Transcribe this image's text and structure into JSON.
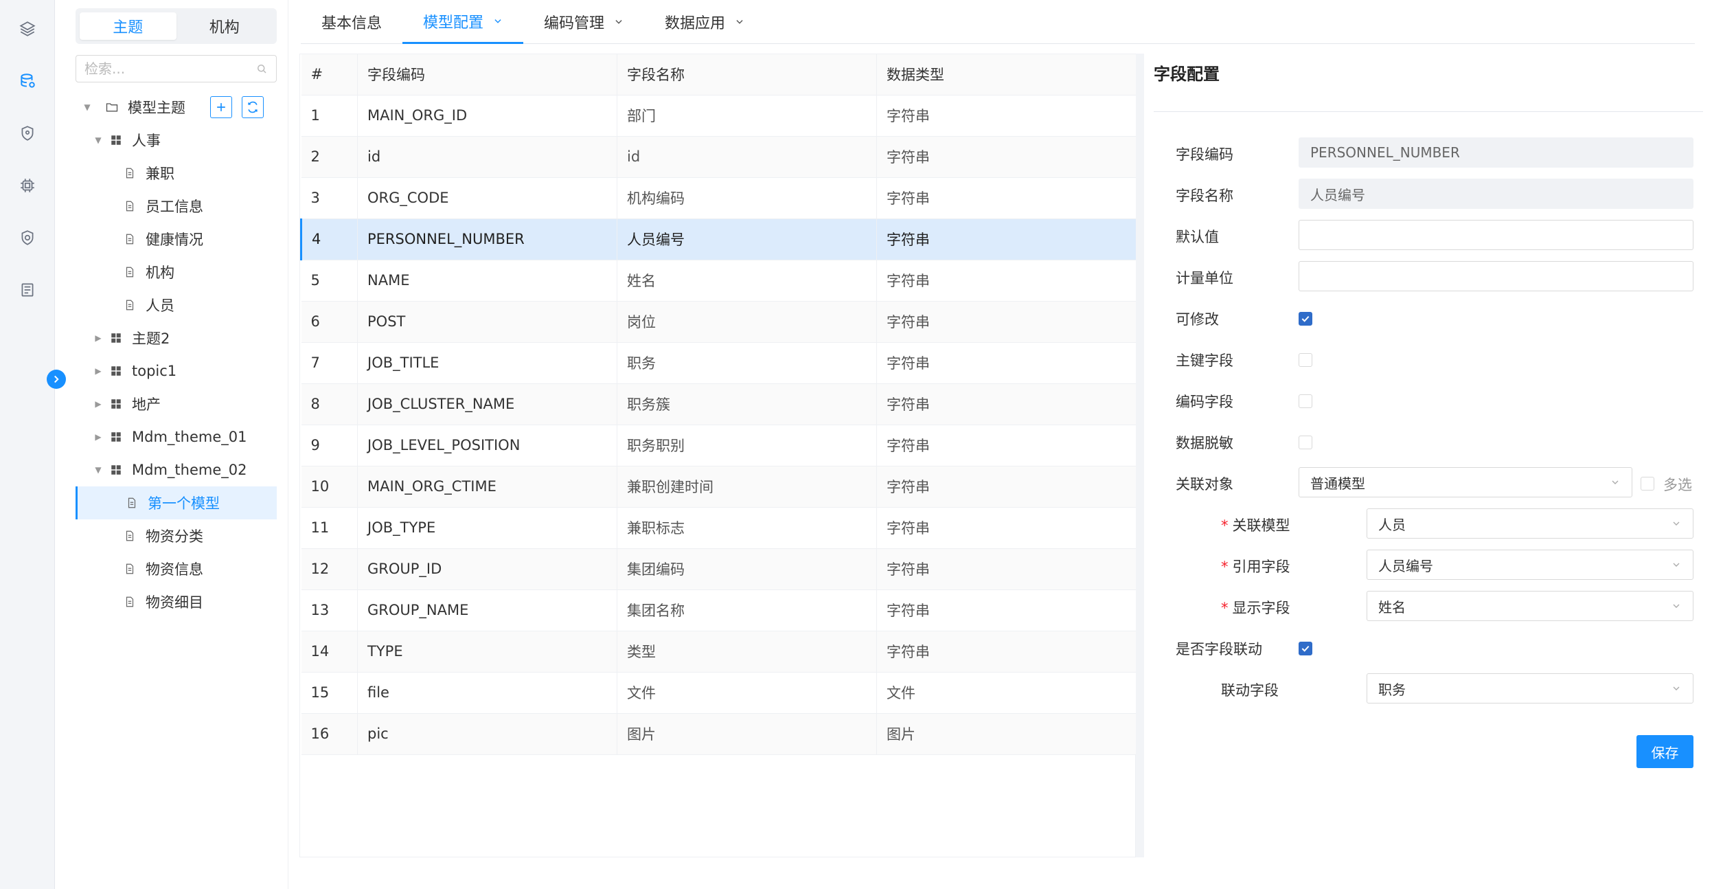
{
  "tree_panel": {
    "segments": [
      "主题",
      "机构"
    ],
    "active_segment": 0,
    "search_placeholder": "检索...",
    "root_label": "模型主题",
    "nodes": [
      {
        "label": "人事",
        "type": "group",
        "level": 1,
        "expanded": true
      },
      {
        "label": "兼职",
        "type": "doc",
        "level": 2
      },
      {
        "label": "员工信息",
        "type": "doc",
        "level": 2
      },
      {
        "label": "健康情况",
        "type": "doc",
        "level": 2
      },
      {
        "label": "机构",
        "type": "doc",
        "level": 2
      },
      {
        "label": "人员",
        "type": "doc",
        "level": 2
      },
      {
        "label": "主题2",
        "type": "group",
        "level": 1,
        "expanded": false
      },
      {
        "label": "topic1",
        "type": "group",
        "level": 1,
        "expanded": false
      },
      {
        "label": "地产",
        "type": "group",
        "level": 1,
        "expanded": false
      },
      {
        "label": "Mdm_theme_01",
        "type": "group",
        "level": 1,
        "expanded": false
      },
      {
        "label": "Mdm_theme_02",
        "type": "group",
        "level": 1,
        "expanded": true
      },
      {
        "label": "第一个模型",
        "type": "doc",
        "level": 2,
        "selected": true
      },
      {
        "label": "物资分类",
        "type": "doc",
        "level": 2
      },
      {
        "label": "物资信息",
        "type": "doc",
        "level": 2
      },
      {
        "label": "物资细目",
        "type": "doc",
        "level": 2
      }
    ]
  },
  "tabs": [
    {
      "label": "基本信息",
      "has_dropdown": false,
      "active": false
    },
    {
      "label": "模型配置",
      "has_dropdown": true,
      "active": true
    },
    {
      "label": "编码管理",
      "has_dropdown": true,
      "active": false
    },
    {
      "label": "数据应用",
      "has_dropdown": true,
      "active": false
    }
  ],
  "table": {
    "headers": [
      "#",
      "字段编码",
      "字段名称",
      "数据类型"
    ],
    "selected_index": 4,
    "rows": [
      [
        "1",
        "MAIN_ORG_ID",
        "部门",
        "字符串"
      ],
      [
        "2",
        "id",
        "id",
        "字符串"
      ],
      [
        "3",
        "ORG_CODE",
        "机构编码",
        "字符串"
      ],
      [
        "4",
        "PERSONNEL_NUMBER",
        "人员编号",
        "字符串"
      ],
      [
        "5",
        "NAME",
        "姓名",
        "字符串"
      ],
      [
        "6",
        "POST",
        "岗位",
        "字符串"
      ],
      [
        "7",
        "JOB_TITLE",
        "职务",
        "字符串"
      ],
      [
        "8",
        "JOB_CLUSTER_NAME",
        "职务簇",
        "字符串"
      ],
      [
        "9",
        "JOB_LEVEL_POSITION",
        "职务职别",
        "字符串"
      ],
      [
        "10",
        "MAIN_ORG_CTIME",
        "兼职创建时间",
        "字符串"
      ],
      [
        "11",
        "JOB_TYPE",
        "兼职标志",
        "字符串"
      ],
      [
        "12",
        "GROUP_ID",
        "集团编码",
        "字符串"
      ],
      [
        "13",
        "GROUP_NAME",
        "集团名称",
        "字符串"
      ],
      [
        "14",
        "TYPE",
        "类型",
        "字符串"
      ],
      [
        "15",
        "file",
        "文件",
        "文件"
      ],
      [
        "16",
        "pic",
        "图片",
        "图片"
      ]
    ]
  },
  "config": {
    "title": "字段配置",
    "field_code_label": "字段编码",
    "field_code_value": "PERSONNEL_NUMBER",
    "field_name_label": "字段名称",
    "field_name_value": "人员编号",
    "default_label": "默认值",
    "default_value": "",
    "unit_label": "计量单位",
    "unit_value": "",
    "editable_label": "可修改",
    "editable_checked": true,
    "pk_label": "主键字段",
    "pk_checked": false,
    "code_field_label": "编码字段",
    "code_field_checked": false,
    "mask_label": "数据脱敏",
    "mask_checked": false,
    "assoc_obj_label": "关联对象",
    "assoc_obj_value": "普通模型",
    "multi_label": "多选",
    "multi_checked": false,
    "assoc_model_label": "关联模型",
    "assoc_model_value": "人员",
    "ref_field_label": "引用字段",
    "ref_field_value": "人员编号",
    "display_field_label": "显示字段",
    "display_field_value": "姓名",
    "linkage_label": "是否字段联动",
    "linkage_checked": true,
    "linkage_field_label": "联动字段",
    "linkage_field_value": "职务",
    "required_mark": "*",
    "save_label": "保存"
  },
  "icons": {
    "rail": [
      "layers-icon",
      "database-icon",
      "shield-icon",
      "chip-icon",
      "security-icon",
      "list-icon"
    ],
    "accent": "#1890ff"
  }
}
